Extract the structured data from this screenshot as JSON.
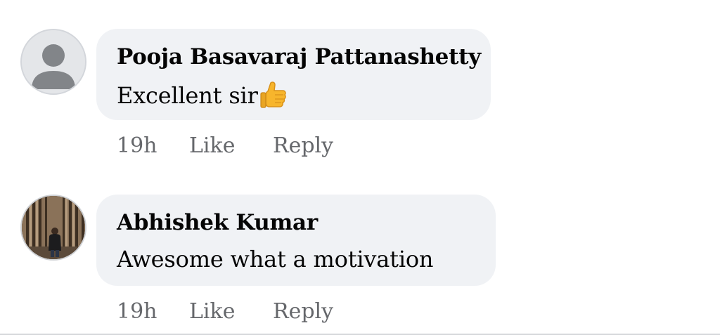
{
  "comments": [
    {
      "author": "Pooja Basavaraj Pattanashetty",
      "text": "Excellent sir",
      "emoji": "thumbs-up",
      "avatar": "default-avatar",
      "time": "19h",
      "like_label": "Like",
      "reply_label": "Reply"
    },
    {
      "author": "Abhishek Kumar",
      "text": "Awesome what a motivation",
      "avatar": "profile-photo",
      "time": "19h",
      "like_label": "Like",
      "reply_label": "Reply"
    }
  ],
  "colors": {
    "bubble_background": "#f0f2f5",
    "author_text": "#050505",
    "meta_text": "#65676b",
    "default_avatar_background": "#e4e6e9",
    "default_avatar_silhouette": "#828589"
  }
}
